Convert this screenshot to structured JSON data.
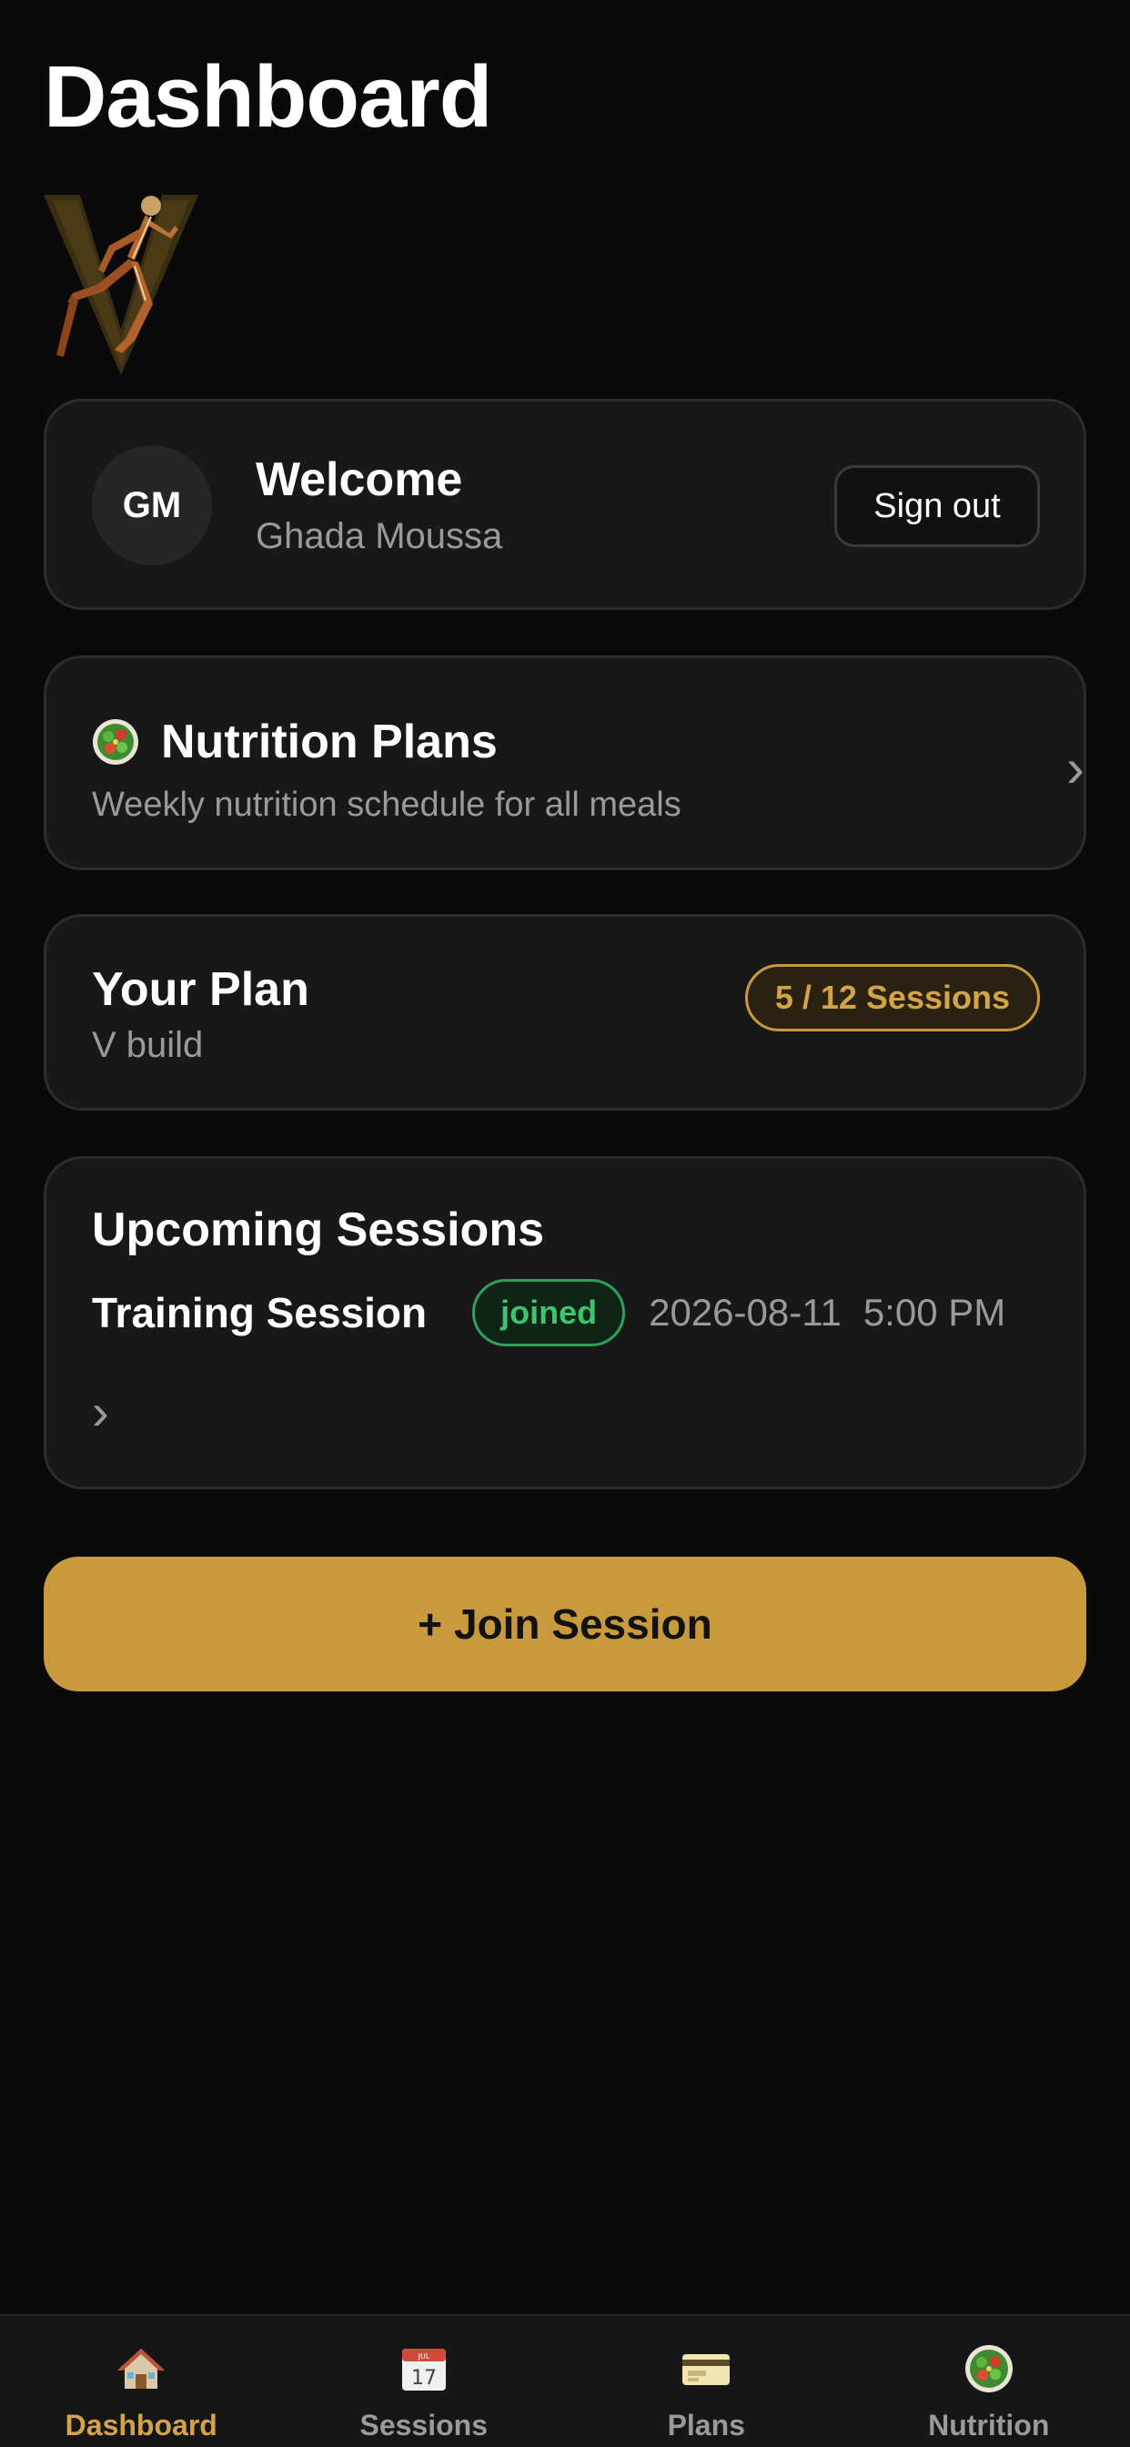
{
  "header": {
    "title": "Dashboard"
  },
  "welcome": {
    "avatar_initials": "GM",
    "title": "Welcome",
    "user_name": "Ghada Moussa",
    "sign_out_label": "Sign out"
  },
  "nutrition_card": {
    "title": "Nutrition Plans",
    "subtitle": "Weekly nutrition schedule for all meals",
    "icon": "salad-icon"
  },
  "plan": {
    "title": "Your Plan",
    "name": "V build",
    "sessions_badge": "5 / 12 Sessions",
    "sessions_used": 5,
    "sessions_total": 12
  },
  "upcoming": {
    "title": "Upcoming Sessions",
    "sessions": [
      {
        "name": "Training Session",
        "status": "joined",
        "date": "2026-08-11",
        "time": "5:00 PM"
      }
    ]
  },
  "join_button": {
    "label": "+ Join Session"
  },
  "tabbar": {
    "items": [
      {
        "label": "Dashboard",
        "icon": "house-icon",
        "active": true
      },
      {
        "label": "Sessions",
        "icon": "calendar-icon",
        "active": false
      },
      {
        "label": "Plans",
        "icon": "card-icon",
        "active": false
      },
      {
        "label": "Nutrition",
        "icon": "salad-icon",
        "active": false
      }
    ]
  },
  "colors": {
    "background": "#0a0a0a",
    "card": "#181818",
    "accent": "#c99a3c",
    "success": "#3cc46e",
    "muted_text": "#9a9a9a"
  }
}
